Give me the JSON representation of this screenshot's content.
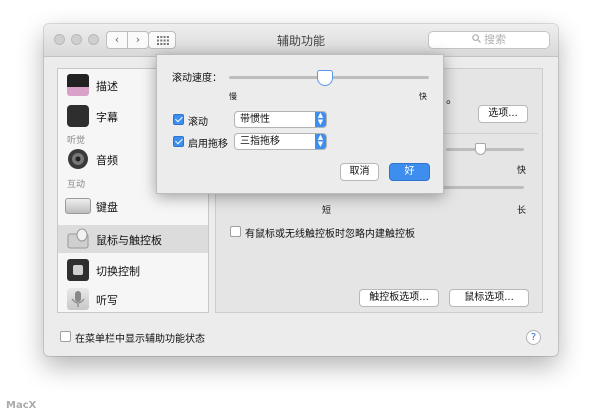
{
  "window": {
    "title": "辅助功能",
    "search_placeholder": "搜索"
  },
  "sidebar": {
    "items": [
      {
        "label": "描述",
        "icon": "display-icon"
      },
      {
        "label": "字幕",
        "icon": "captions-icon"
      },
      {
        "label": "音频",
        "icon": "speaker-icon"
      },
      {
        "label": "键盘",
        "icon": "keyboard-icon"
      },
      {
        "label": "鼠标与触控板",
        "icon": "mouse-trackpad-icon",
        "selected": true
      },
      {
        "label": "切换控制",
        "icon": "switch-control-icon"
      },
      {
        "label": "听写",
        "icon": "microphone-icon"
      }
    ],
    "sections": {
      "hearing": "听觉",
      "interaction": "互动"
    }
  },
  "content": {
    "partial_text": "。",
    "options_button": "选项...",
    "fast_label": "快",
    "short_label": "短",
    "long_label": "长",
    "ignore_checkbox_label": "有鼠标或无线触控板时忽略内建触控板",
    "ignore_checked": false,
    "trackpad_options_button": "触控板选项...",
    "mouse_options_button": "鼠标选项..."
  },
  "footer": {
    "show_status_label": "在菜单栏中显示辅助功能状态",
    "show_status_checked": false,
    "help": "?"
  },
  "sheet": {
    "scroll_speed_label": "滚动速度：",
    "scroll_speed_value": 0.48,
    "slow_label": "慢",
    "fast_label": "快",
    "scrolling": {
      "label": "滚动",
      "checked": true,
      "selected": "带惯性"
    },
    "dragging": {
      "label": "启用拖移",
      "checked": true,
      "selected": "三指拖移"
    },
    "cancel_button": "取消",
    "ok_button": "好"
  },
  "colors": {
    "accent": "#3e8ef0"
  },
  "watermark": "MacX"
}
